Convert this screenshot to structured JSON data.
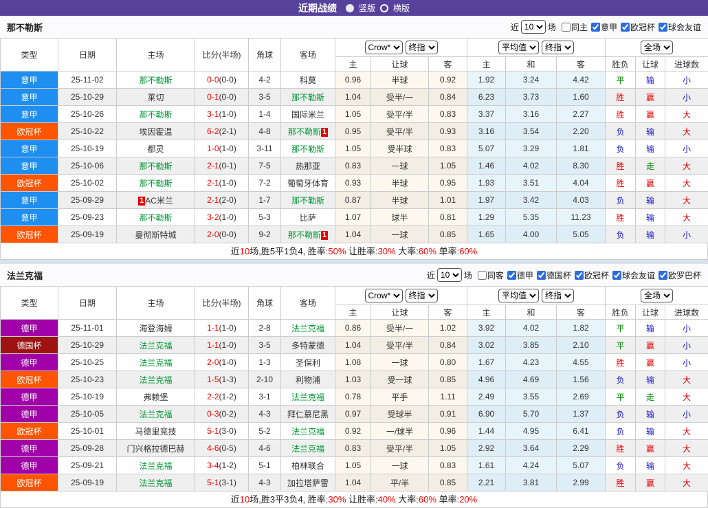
{
  "topbar": {
    "title": "近期战绩",
    "radios": [
      {
        "label": "竖版",
        "selected": true
      },
      {
        "label": "横版",
        "selected": false
      }
    ],
    "bg": "#56429b"
  },
  "table_header": {
    "static": [
      "类型",
      "日期",
      "主场",
      "比分(半场)",
      "角球",
      "客场"
    ],
    "groups": [
      {
        "selects": [
          "Crow*",
          "终指"
        ],
        "cols": [
          "主",
          "让球",
          "客"
        ]
      },
      {
        "selects": [
          "平均值",
          "终指"
        ],
        "cols": [
          "主",
          "和",
          "客"
        ]
      },
      {
        "selects": [
          "全场"
        ],
        "cols": [
          "胜负",
          "让球",
          "进球数"
        ]
      }
    ]
  },
  "type_colors": {
    "意甲": "#1e8ff0",
    "欧冠杯": "#ff5400",
    "德甲": "#a000a8",
    "德国杯": "#9e1212"
  },
  "result_colors": {
    "r": "#e60000",
    "b": "#1515cd",
    "g": "#008800"
  },
  "team_win_color": "#009933",
  "score_color": "#ff0000",
  "sections": [
    {
      "team": "那不勒斯",
      "filter": {
        "prefix": "近",
        "count": "10",
        "suffix": "场",
        "same": {
          "label": "同主",
          "checked": false
        },
        "leagues": [
          {
            "label": "意甲",
            "checked": true
          },
          {
            "label": "欧冠杯",
            "checked": true
          },
          {
            "label": "球会友谊",
            "checked": true
          }
        ]
      },
      "rows": [
        {
          "type": "意甲",
          "date": "25-11-02",
          "home": {
            "name": "那不勒斯",
            "green": true
          },
          "score": "0-0",
          "half": "(0-0)",
          "corner": "4-2",
          "away": {
            "name": "科莫"
          },
          "odds": [
            "0.96",
            "半球",
            "0.92"
          ],
          "avg": [
            "1.92",
            "3.24",
            "4.42"
          ],
          "res": [
            [
              "平",
              "g"
            ],
            [
              "输",
              "b"
            ],
            [
              "小",
              "b"
            ]
          ]
        },
        {
          "type": "意甲",
          "date": "25-10-29",
          "home": {
            "name": "莱切"
          },
          "score": "0-1",
          "half": "(0-0)",
          "corner": "3-5",
          "away": {
            "name": "那不勒斯",
            "green": true
          },
          "odds": [
            "1.04",
            "受半/一",
            "0.84"
          ],
          "avg": [
            "6.23",
            "3.73",
            "1.60"
          ],
          "res": [
            [
              "胜",
              "r"
            ],
            [
              "赢",
              "r"
            ],
            [
              "小",
              "b"
            ]
          ]
        },
        {
          "type": "意甲",
          "date": "25-10-26",
          "home": {
            "name": "那不勒斯",
            "green": true
          },
          "score": "3-1",
          "half": "(1-0)",
          "corner": "1-4",
          "away": {
            "name": "国际米兰"
          },
          "odds": [
            "1.05",
            "受平/半",
            "0.83"
          ],
          "avg": [
            "3.37",
            "3.16",
            "2.27"
          ],
          "res": [
            [
              "胜",
              "r"
            ],
            [
              "赢",
              "r"
            ],
            [
              "大",
              "r"
            ]
          ]
        },
        {
          "type": "欧冠杯",
          "date": "25-10-22",
          "home": {
            "name": "埃因霍温"
          },
          "score": "6-2",
          "half": "(2-1)",
          "corner": "4-8",
          "away": {
            "name": "那不勒斯",
            "green": true,
            "badge": "1"
          },
          "odds": [
            "0.95",
            "受平/半",
            "0.93"
          ],
          "avg": [
            "3.16",
            "3.54",
            "2.20"
          ],
          "res": [
            [
              "负",
              "b"
            ],
            [
              "输",
              "b"
            ],
            [
              "大",
              "r"
            ]
          ]
        },
        {
          "type": "意甲",
          "date": "25-10-19",
          "home": {
            "name": "都灵"
          },
          "score": "1-0",
          "half": "(1-0)",
          "corner": "3-11",
          "away": {
            "name": "那不勒斯",
            "green": true
          },
          "odds": [
            "1.05",
            "受半球",
            "0.83"
          ],
          "avg": [
            "5.07",
            "3.29",
            "1.81"
          ],
          "res": [
            [
              "负",
              "b"
            ],
            [
              "输",
              "b"
            ],
            [
              "小",
              "b"
            ]
          ]
        },
        {
          "type": "意甲",
          "date": "25-10-06",
          "home": {
            "name": "那不勒斯",
            "green": true
          },
          "score": "2-1",
          "half": "(0-1)",
          "corner": "7-5",
          "away": {
            "name": "热那亚"
          },
          "odds": [
            "0.83",
            "一球",
            "1.05"
          ],
          "avg": [
            "1.46",
            "4.02",
            "8.30"
          ],
          "res": [
            [
              "胜",
              "r"
            ],
            [
              "走",
              "g"
            ],
            [
              "大",
              "r"
            ]
          ]
        },
        {
          "type": "欧冠杯",
          "date": "25-10-02",
          "home": {
            "name": "那不勒斯",
            "green": true
          },
          "score": "2-1",
          "half": "(1-0)",
          "corner": "7-2",
          "away": {
            "name": "葡萄牙体育"
          },
          "odds": [
            "0.93",
            "半球",
            "0.95"
          ],
          "avg": [
            "1.93",
            "3.51",
            "4.04"
          ],
          "res": [
            [
              "胜",
              "r"
            ],
            [
              "赢",
              "r"
            ],
            [
              "大",
              "r"
            ]
          ]
        },
        {
          "type": "意甲",
          "date": "25-09-29",
          "home": {
            "name": "AC米兰",
            "badge_before": "1"
          },
          "score": "2-1",
          "half": "(2-0)",
          "corner": "1-7",
          "away": {
            "name": "那不勒斯",
            "green": true
          },
          "odds": [
            "0.87",
            "半球",
            "1.01"
          ],
          "avg": [
            "1.97",
            "3.42",
            "4.03"
          ],
          "res": [
            [
              "负",
              "b"
            ],
            [
              "输",
              "b"
            ],
            [
              "大",
              "r"
            ]
          ]
        },
        {
          "type": "意甲",
          "date": "25-09-23",
          "home": {
            "name": "那不勒斯",
            "green": true
          },
          "score": "3-2",
          "half": "(1-0)",
          "corner": "5-3",
          "away": {
            "name": "比萨"
          },
          "odds": [
            "1.07",
            "球半",
            "0.81"
          ],
          "avg": [
            "1.29",
            "5.35",
            "11.23"
          ],
          "res": [
            [
              "胜",
              "r"
            ],
            [
              "输",
              "b"
            ],
            [
              "大",
              "r"
            ]
          ]
        },
        {
          "type": "欧冠杯",
          "date": "25-09-19",
          "home": {
            "name": "曼彻斯特城"
          },
          "score": "2-0",
          "half": "(0-0)",
          "corner": "9-2",
          "away": {
            "name": "那不勒斯",
            "green": true,
            "badge": "1"
          },
          "odds": [
            "1.04",
            "一球",
            "0.85"
          ],
          "avg": [
            "1.65",
            "4.00",
            "5.05"
          ],
          "res": [
            [
              "负",
              "b"
            ],
            [
              "输",
              "b"
            ],
            [
              "小",
              "b"
            ]
          ]
        }
      ],
      "summary": [
        [
          "近",
          "k"
        ],
        [
          "10",
          "r"
        ],
        [
          "场,胜5平1负4, 胜率:",
          "k"
        ],
        [
          "50%",
          "r"
        ],
        [
          " 让胜率:",
          "k"
        ],
        [
          "30%",
          "r"
        ],
        [
          " 大率:",
          "k"
        ],
        [
          "60%",
          "r"
        ],
        [
          " 单率:",
          "k"
        ],
        [
          "60%",
          "r"
        ]
      ]
    },
    {
      "team": "法兰克福",
      "filter": {
        "prefix": "近",
        "count": "10",
        "suffix": "场",
        "same": {
          "label": "同客",
          "checked": false
        },
        "leagues": [
          {
            "label": "德甲",
            "checked": true
          },
          {
            "label": "德国杯",
            "checked": true
          },
          {
            "label": "欧冠杯",
            "checked": true
          },
          {
            "label": "球会友谊",
            "checked": true
          },
          {
            "label": "欧罗巴杯",
            "checked": true
          }
        ]
      },
      "rows": [
        {
          "type": "德甲",
          "date": "25-11-01",
          "home": {
            "name": "海登海姆"
          },
          "score": "1-1",
          "half": "(1-0)",
          "corner": "2-8",
          "away": {
            "name": "法兰克福",
            "green": true
          },
          "odds": [
            "0.86",
            "受半/一",
            "1.02"
          ],
          "avg": [
            "3.92",
            "4.02",
            "1.82"
          ],
          "res": [
            [
              "平",
              "g"
            ],
            [
              "输",
              "b"
            ],
            [
              "小",
              "b"
            ]
          ]
        },
        {
          "type": "德国杯",
          "date": "25-10-29",
          "home": {
            "name": "法兰克福",
            "green": true
          },
          "score": "1-1",
          "half": "(1-0)",
          "corner": "3-5",
          "away": {
            "name": "多特蒙德"
          },
          "odds": [
            "1.04",
            "受平/半",
            "0.84"
          ],
          "avg": [
            "3.02",
            "3.85",
            "2.10"
          ],
          "res": [
            [
              "平",
              "g"
            ],
            [
              "赢",
              "r"
            ],
            [
              "小",
              "b"
            ]
          ]
        },
        {
          "type": "德甲",
          "date": "25-10-25",
          "home": {
            "name": "法兰克福",
            "green": true
          },
          "score": "2-0",
          "half": "(1-0)",
          "corner": "1-3",
          "away": {
            "name": "圣保利"
          },
          "odds": [
            "1.08",
            "一球",
            "0.80"
          ],
          "avg": [
            "1.67",
            "4.23",
            "4.55"
          ],
          "res": [
            [
              "胜",
              "r"
            ],
            [
              "赢",
              "r"
            ],
            [
              "小",
              "b"
            ]
          ]
        },
        {
          "type": "欧冠杯",
          "date": "25-10-23",
          "home": {
            "name": "法兰克福",
            "green": true
          },
          "score": "1-5",
          "half": "(1-3)",
          "corner": "2-10",
          "away": {
            "name": "利物浦"
          },
          "odds": [
            "1.03",
            "受一球",
            "0.85"
          ],
          "avg": [
            "4.96",
            "4.69",
            "1.56"
          ],
          "res": [
            [
              "负",
              "b"
            ],
            [
              "输",
              "b"
            ],
            [
              "大",
              "r"
            ]
          ]
        },
        {
          "type": "德甲",
          "date": "25-10-19",
          "home": {
            "name": "弗赖堡"
          },
          "score": "2-2",
          "half": "(1-2)",
          "corner": "3-1",
          "away": {
            "name": "法兰克福",
            "green": true
          },
          "odds": [
            "0.78",
            "平手",
            "1.11"
          ],
          "avg": [
            "2.49",
            "3.55",
            "2.69"
          ],
          "res": [
            [
              "平",
              "g"
            ],
            [
              "走",
              "g"
            ],
            [
              "大",
              "r"
            ]
          ]
        },
        {
          "type": "德甲",
          "date": "25-10-05",
          "home": {
            "name": "法兰克福",
            "green": true
          },
          "score": "0-3",
          "half": "(0-2)",
          "corner": "4-3",
          "away": {
            "name": "拜仁慕尼黑"
          },
          "odds": [
            "0.97",
            "受球半",
            "0.91"
          ],
          "avg": [
            "6.90",
            "5.70",
            "1.37"
          ],
          "res": [
            [
              "负",
              "b"
            ],
            [
              "输",
              "b"
            ],
            [
              "小",
              "b"
            ]
          ]
        },
        {
          "type": "欧冠杯",
          "date": "25-10-01",
          "home": {
            "name": "马德里竞技"
          },
          "score": "5-1",
          "half": "(3-0)",
          "corner": "5-2",
          "away": {
            "name": "法兰克福",
            "green": true
          },
          "odds": [
            "0.92",
            "一/球半",
            "0.96"
          ],
          "avg": [
            "1.44",
            "4.95",
            "6.41"
          ],
          "res": [
            [
              "负",
              "b"
            ],
            [
              "输",
              "b"
            ],
            [
              "大",
              "r"
            ]
          ]
        },
        {
          "type": "德甲",
          "date": "25-09-28",
          "home": {
            "name": "门兴格拉德巴赫"
          },
          "score": "4-6",
          "half": "(0-5)",
          "corner": "4-6",
          "away": {
            "name": "法兰克福",
            "green": true
          },
          "odds": [
            "0.83",
            "受平/半",
            "1.05"
          ],
          "avg": [
            "2.92",
            "3.64",
            "2.29"
          ],
          "res": [
            [
              "胜",
              "r"
            ],
            [
              "赢",
              "r"
            ],
            [
              "大",
              "r"
            ]
          ]
        },
        {
          "type": "德甲",
          "date": "25-09-21",
          "home": {
            "name": "法兰克福",
            "green": true
          },
          "score": "3-4",
          "half": "(1-2)",
          "corner": "5-1",
          "away": {
            "name": "柏林联合"
          },
          "odds": [
            "1.05",
            "一球",
            "0.83"
          ],
          "avg": [
            "1.61",
            "4.24",
            "5.07"
          ],
          "res": [
            [
              "负",
              "b"
            ],
            [
              "输",
              "b"
            ],
            [
              "大",
              "r"
            ]
          ]
        },
        {
          "type": "欧冠杯",
          "date": "25-09-19",
          "home": {
            "name": "法兰克福",
            "green": true
          },
          "score": "5-1",
          "half": "(3-1)",
          "corner": "4-3",
          "away": {
            "name": "加拉塔萨雷"
          },
          "odds": [
            "1.04",
            "平/半",
            "0.85"
          ],
          "avg": [
            "2.21",
            "3.81",
            "2.99"
          ],
          "res": [
            [
              "胜",
              "r"
            ],
            [
              "赢",
              "r"
            ],
            [
              "大",
              "r"
            ]
          ]
        }
      ],
      "summary": [
        [
          "近",
          "k"
        ],
        [
          "10",
          "r"
        ],
        [
          "场,胜3平3负4, 胜率:",
          "k"
        ],
        [
          "30%",
          "r"
        ],
        [
          " 让胜率:",
          "k"
        ],
        [
          "40%",
          "r"
        ],
        [
          " 大率:",
          "k"
        ],
        [
          "60%",
          "r"
        ],
        [
          " 单率:",
          "k"
        ],
        [
          "20%",
          "r"
        ]
      ]
    }
  ]
}
